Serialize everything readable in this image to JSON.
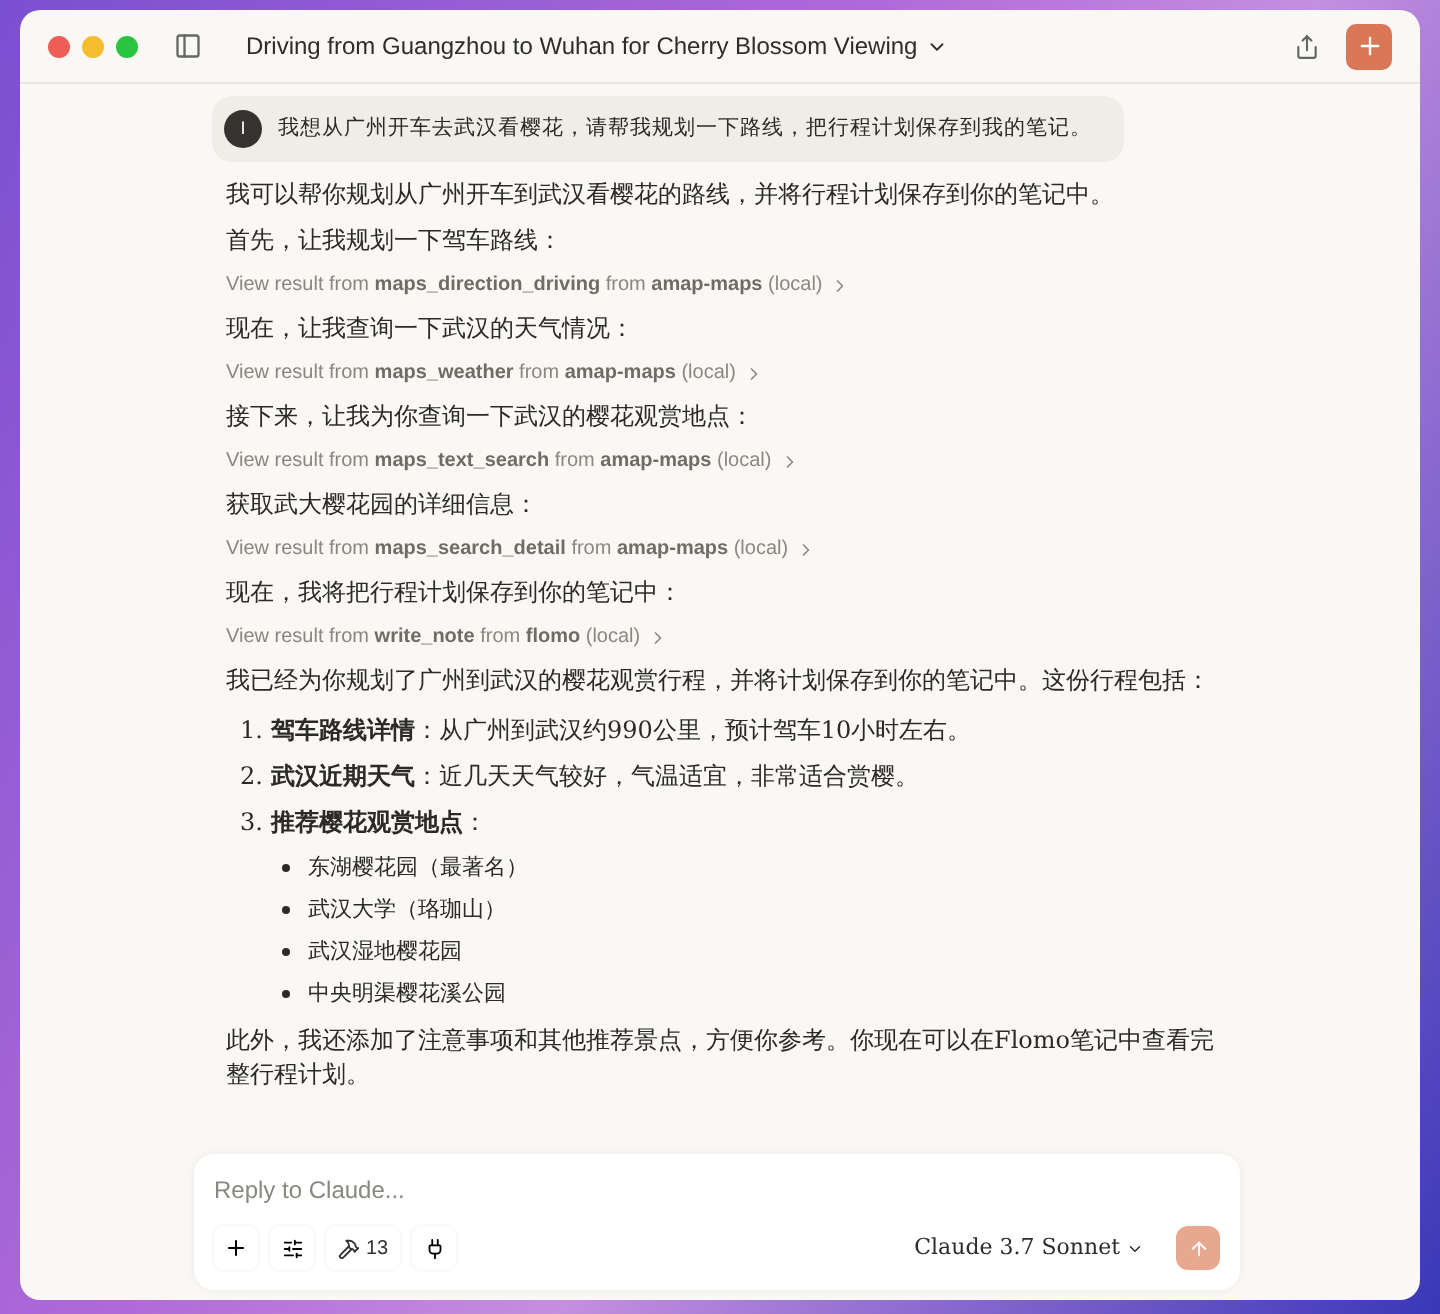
{
  "window": {
    "title": "Driving from Guangzhou to Wuhan for Cherry Blossom Viewing"
  },
  "user_message": {
    "avatar": "I",
    "text": "我想从广州开车去武汉看樱花，请帮我规划一下路线，把行程计划保存到我的笔记。"
  },
  "messages": [
    {
      "kind": "paragraph",
      "text": "我可以帮你规划从广州开车到武汉看樱花的路线，并将行程计划保存到你的笔记中。"
    },
    {
      "kind": "paragraph",
      "text": "首先，让我规划一下驾车路线："
    },
    {
      "kind": "tool",
      "text": "View result from **maps_direction_driving** from **amap-maps** (local)"
    },
    {
      "kind": "paragraph",
      "text": "现在，让我查询一下武汉的天气情况："
    },
    {
      "kind": "tool",
      "text": "View result from **maps_weather** from **amap-maps** (local)"
    },
    {
      "kind": "paragraph",
      "text": "接下来，让我为你查询一下武汉的樱花观赏地点："
    },
    {
      "kind": "tool",
      "text": "View result from **maps_text_search** from **amap-maps** (local)"
    },
    {
      "kind": "paragraph",
      "text": "获取武大樱花园的详细信息："
    },
    {
      "kind": "tool",
      "text": "View result from **maps_search_detail** from **amap-maps** (local)"
    },
    {
      "kind": "paragraph",
      "text": "现在，我将把行程计划保存到你的笔记中："
    },
    {
      "kind": "tool",
      "text": "View result from **write_note** from **flomo** (local)"
    },
    {
      "kind": "paragraph",
      "text": "我已经为你规划了广州到武汉的樱花观赏行程，并将计划保存到你的笔记中。这份行程包括："
    },
    {
      "kind": "list",
      "items": [
        {
          "number": "1.",
          "text": "**驾车路线详情**：从广州到武汉约990公里，预计驾车10小时左右。"
        },
        {
          "number": "2.",
          "text": "**武汉近期天气**：近几天天气较好，气温适宜，非常适合赏樱。"
        },
        {
          "number": "3.",
          "text": "**推荐樱花观赏地点**：",
          "children": [
            "东湖樱花园（最著名）",
            "武汉大学（珞珈山）",
            "武汉湿地樱花园",
            "中央明渠樱花溪公园"
          ]
        }
      ]
    },
    {
      "kind": "paragraph",
      "text": "此外，我还添加了注意事项和其他推荐景点，方便你参考。你现在可以在Flomo笔记中查看完整行程计划。"
    }
  ],
  "composer": {
    "placeholder": "Reply to Claude...",
    "tools_count": "13",
    "model": "Claude 3.7 Sonnet"
  }
}
